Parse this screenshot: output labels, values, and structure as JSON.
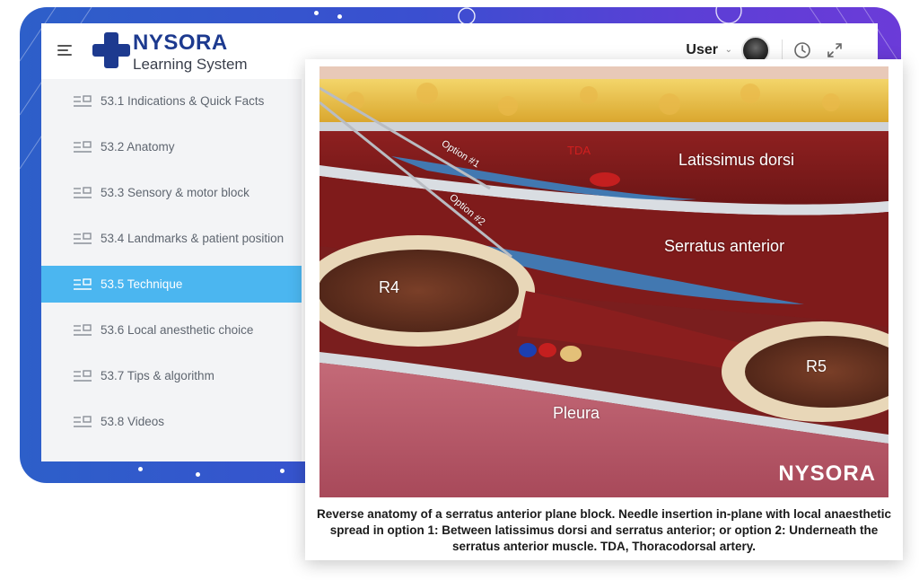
{
  "app": {
    "brand_word": "NYSORA",
    "brand_subtitle": "Learning System",
    "accent_color": "#4bb6f0",
    "brand_color": "#1d3a8f"
  },
  "header": {
    "user_label": "User",
    "icons": [
      "menu-icon",
      "chevron-down-icon",
      "avatar",
      "history-icon",
      "expand-icon"
    ]
  },
  "sidebar": {
    "items": [
      {
        "label": "53.1 Indications & Quick Facts",
        "active": false
      },
      {
        "label": "53.2 Anatomy",
        "active": false
      },
      {
        "label": "53.3 Sensory & motor block",
        "active": false
      },
      {
        "label": "53.4 Landmarks & patient position",
        "active": false
      },
      {
        "label": "53.5 Technique",
        "active": true
      },
      {
        "label": "53.6 Local anesthetic choice",
        "active": false
      },
      {
        "label": "53.7 Tips & algorithm",
        "active": false
      },
      {
        "label": "53.8 Videos",
        "active": false
      }
    ]
  },
  "figure": {
    "labels": {
      "option1": "Option #1",
      "option2": "Option #2",
      "tda": "TDA",
      "latissimus": "Latissimus dorsi",
      "serratus": "Serratus anterior",
      "r4": "R4",
      "r5": "R5",
      "pleura": "Pleura"
    },
    "watermark": "NYSORA",
    "caption": "Reverse anatomy of a serratus anterior plane block. Needle insertion in-plane with local anaesthetic spread in option 1: Between latissimus dorsi and serratus anterior; or option 2: Underneath the serratus anterior muscle. TDA, Thoracodorsal artery."
  }
}
